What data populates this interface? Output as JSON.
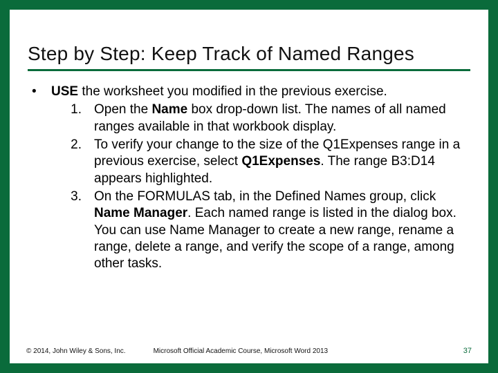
{
  "title": "Step by Step: Keep Track of Named Ranges",
  "lead_pre": "USE",
  "lead_post": " the worksheet you modified in the previous exercise.",
  "steps": [
    {
      "num": "1.",
      "parts": [
        "Open the ",
        "Name",
        " box drop-down list. The names of all named ranges available in that workbook display."
      ]
    },
    {
      "num": "2.",
      "parts": [
        "To verify your change to the size of the Q1Expenses range in a previous exercise, select ",
        "Q1Expenses",
        ". The range B3:D14 appears highlighted."
      ]
    },
    {
      "num": "3.",
      "parts": [
        "On the FORMULAS tab, in the Defined Names group, click ",
        "Name Manager",
        ". Each named range is listed in the dialog box. You can use Name Manager to create a new range, rename a range, delete a range, and verify the scope of a range, among other tasks."
      ]
    }
  ],
  "footer": {
    "copyright": "© 2014, John Wiley & Sons, Inc.",
    "course": "Microsoft Official Academic Course, Microsoft Word 2013",
    "page": "37"
  }
}
